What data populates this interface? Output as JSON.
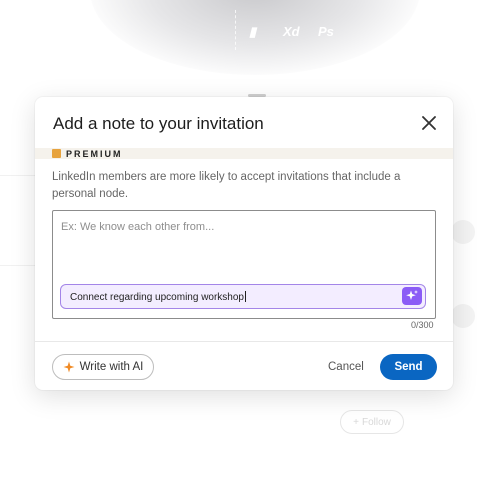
{
  "background": {
    "toolbar_icons": [
      "Xd",
      "Ps"
    ],
    "follow_label": "Follow"
  },
  "dialog": {
    "title": "Add a note to your invitation",
    "close_icon": "close-icon",
    "premium_label": "PREMIUM",
    "premium_color": "#e7a33e",
    "info_text": "LinkedIn members are more likely to accept invitations that include a personal node.",
    "textarea_placeholder": "Ex: We know each other from...",
    "ai_prompt_value": "Connect regarding upcoming workshop",
    "ai_sparkle_icon": "sparkle-icon",
    "char_count": "0/300",
    "write_ai_label": "Write with AI",
    "cancel_label": "Cancel",
    "send_label": "Send",
    "accent_color": "#0a66c2",
    "ai_color": "#8b5cf6"
  }
}
